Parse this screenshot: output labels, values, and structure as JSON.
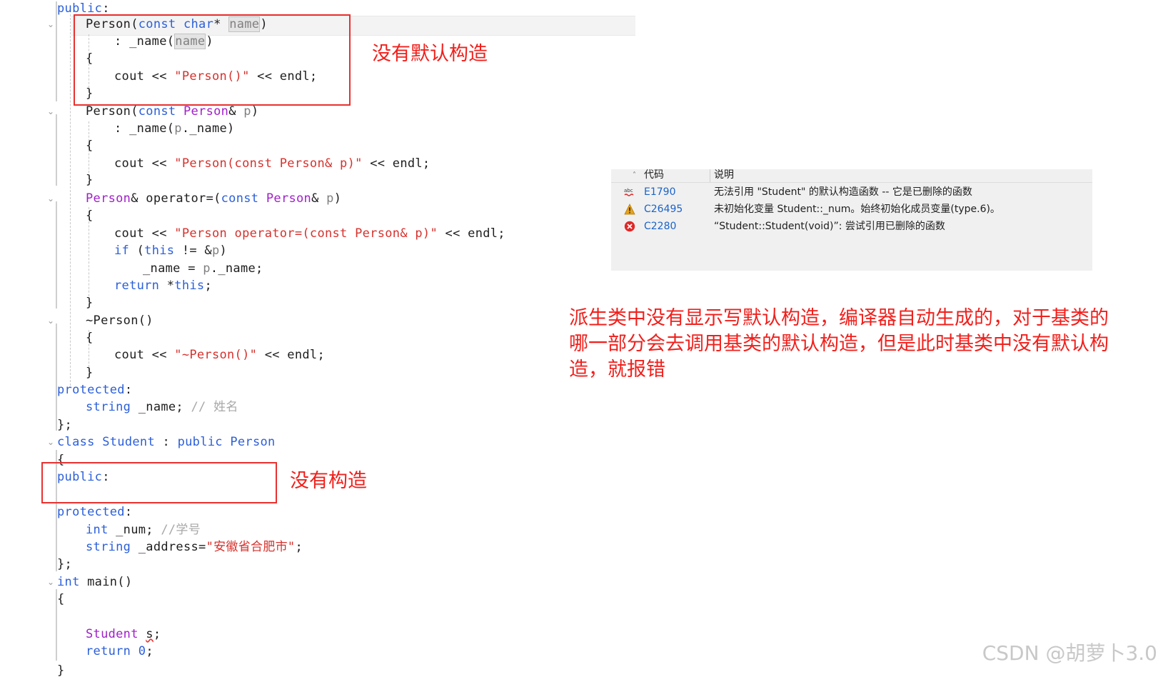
{
  "editor": {
    "lines": [
      {
        "segs": [
          {
            "c": "kw",
            "t": "public"
          },
          {
            "t": ":"
          }
        ]
      },
      {
        "segs": [
          {
            "t": "Person("
          },
          {
            "c": "kw",
            "t": "const"
          },
          {
            "t": " "
          },
          {
            "c": "kw",
            "t": "char"
          },
          {
            "t": "* "
          },
          {
            "c": "hl",
            "t": "name"
          },
          {
            "t": ")"
          }
        ]
      },
      {
        "segs": [
          {
            "t": ": _name("
          },
          {
            "c": "hl",
            "t": "name"
          },
          {
            "t": ")"
          }
        ]
      },
      {
        "segs": [
          {
            "t": "{"
          }
        ]
      },
      {
        "segs": [
          {
            "t": "cout << "
          },
          {
            "c": "str",
            "t": "\"Person()\""
          },
          {
            "t": " << endl;"
          }
        ]
      },
      {
        "segs": [
          {
            "t": "}"
          }
        ]
      },
      {
        "segs": [
          {
            "t": "Person("
          },
          {
            "c": "kw",
            "t": "const"
          },
          {
            "t": " "
          },
          {
            "c": "type",
            "t": "Person"
          },
          {
            "t": "& "
          },
          {
            "c": "param",
            "t": "p"
          },
          {
            "t": ")"
          }
        ]
      },
      {
        "segs": [
          {
            "t": ": _name("
          },
          {
            "c": "param",
            "t": "p"
          },
          {
            "t": "._name)"
          }
        ]
      },
      {
        "segs": [
          {
            "t": "{"
          }
        ]
      },
      {
        "segs": [
          {
            "t": "cout << "
          },
          {
            "c": "str",
            "t": "\"Person(const Person& p)\""
          },
          {
            "t": " << endl;"
          }
        ]
      },
      {
        "segs": [
          {
            "t": "}"
          }
        ]
      },
      {
        "segs": [
          {
            "c": "type",
            "t": "Person"
          },
          {
            "t": "& operator=("
          },
          {
            "c": "kw",
            "t": "const"
          },
          {
            "t": " "
          },
          {
            "c": "type",
            "t": "Person"
          },
          {
            "t": "& "
          },
          {
            "c": "param",
            "t": "p"
          },
          {
            "t": ")"
          }
        ]
      },
      {
        "segs": [
          {
            "t": "{"
          }
        ]
      },
      {
        "segs": [
          {
            "t": "cout << "
          },
          {
            "c": "str",
            "t": "\"Person operator=(const Person& p)\""
          },
          {
            "t": " << endl;"
          }
        ]
      },
      {
        "segs": [
          {
            "c": "kw",
            "t": "if"
          },
          {
            "t": " ("
          },
          {
            "c": "kw",
            "t": "this"
          },
          {
            "t": " != &"
          },
          {
            "c": "param",
            "t": "p"
          },
          {
            "t": ")"
          }
        ]
      },
      {
        "segs": [
          {
            "t": "_name = "
          },
          {
            "c": "param",
            "t": "p"
          },
          {
            "t": "._name;"
          }
        ]
      },
      {
        "segs": [
          {
            "c": "kw",
            "t": "return"
          },
          {
            "t": " *"
          },
          {
            "c": "kw",
            "t": "this"
          },
          {
            "t": ";"
          }
        ]
      },
      {
        "segs": [
          {
            "t": "}"
          }
        ]
      },
      {
        "segs": [
          {
            "t": "~Person()"
          }
        ]
      },
      {
        "segs": [
          {
            "t": "{"
          }
        ]
      },
      {
        "segs": [
          {
            "t": "cout << "
          },
          {
            "c": "str",
            "t": "\"~Person()\""
          },
          {
            "t": " << endl;"
          }
        ]
      },
      {
        "segs": [
          {
            "t": "}"
          }
        ]
      },
      {
        "segs": [
          {
            "c": "kw",
            "t": "protected"
          },
          {
            "t": ":"
          }
        ]
      },
      {
        "segs": [
          {
            "c": "kw",
            "t": "string"
          },
          {
            "t": " _name; "
          },
          {
            "c": "cmt",
            "t": "// 姓名"
          }
        ]
      },
      {
        "segs": [
          {
            "t": "};"
          }
        ]
      },
      {
        "segs": [
          {
            "c": "kw",
            "t": "class"
          },
          {
            "t": " "
          },
          {
            "c": "kw",
            "t": "Student"
          },
          {
            "t": " : "
          },
          {
            "c": "kw",
            "t": "public"
          },
          {
            "t": " "
          },
          {
            "c": "kw",
            "t": "Person"
          }
        ]
      },
      {
        "segs": [
          {
            "t": "{"
          }
        ]
      },
      {
        "segs": [
          {
            "c": "kw",
            "t": "public"
          },
          {
            "t": ":"
          }
        ]
      },
      {
        "segs": []
      },
      {
        "segs": [
          {
            "c": "kw",
            "t": "protected"
          },
          {
            "t": ":"
          }
        ]
      },
      {
        "segs": [
          {
            "c": "kw",
            "t": "int"
          },
          {
            "t": " _num; "
          },
          {
            "c": "cmt",
            "t": "//学号"
          }
        ]
      },
      {
        "segs": [
          {
            "c": "kw",
            "t": "string"
          },
          {
            "t": " _address="
          },
          {
            "c": "str",
            "t": "\"安徽省合肥市\""
          },
          {
            "t": ";"
          }
        ]
      },
      {
        "segs": [
          {
            "t": "};"
          }
        ]
      },
      {
        "segs": [
          {
            "c": "kw",
            "t": "int"
          },
          {
            "t": " main()"
          }
        ]
      },
      {
        "segs": [
          {
            "t": "{"
          }
        ]
      },
      {
        "segs": []
      },
      {
        "segs": [
          {
            "c": "type",
            "t": "Student"
          },
          {
            "t": " "
          },
          {
            "c": "sq",
            "t": "s"
          },
          {
            "t": ";"
          }
        ]
      },
      {
        "segs": [
          {
            "c": "kw",
            "t": "return"
          },
          {
            "t": " "
          },
          {
            "c": "kw",
            "t": "0"
          },
          {
            "t": ";"
          }
        ]
      },
      {
        "segs": [
          {
            "t": "}"
          }
        ]
      }
    ]
  },
  "annotations": {
    "no_default_ctor": "没有默认构造",
    "no_ctor": "没有构造",
    "explanation": "派生类中没有显示写默认构造，编译器自动生成的，对于基类的哪一部分会去调用基类的默认构造，但是此时基类中没有默认构造，就报错"
  },
  "error_list": {
    "header_code": "代码",
    "header_desc": "说明",
    "rows": [
      {
        "icon": "spelling-icon",
        "code": "E1790",
        "desc": "无法引用 \"Student\" 的默认构造函数 -- 它是已删除的函数"
      },
      {
        "icon": "warning-icon",
        "code": "C26495",
        "desc": "未初始化变量 Student::_num。始终初始化成员变量(type.6)。"
      },
      {
        "icon": "error-icon",
        "code": "C2280",
        "desc": "“Student::Student(void)”: 尝试引用已删除的函数"
      }
    ]
  },
  "watermark": "CSDN @胡萝卜3.0",
  "colors": {
    "keyword": "#2b5fd9",
    "type": "#a020c8",
    "string": "#d6312c",
    "comment": "#a8a8a8",
    "annotation": "#f0201c"
  }
}
